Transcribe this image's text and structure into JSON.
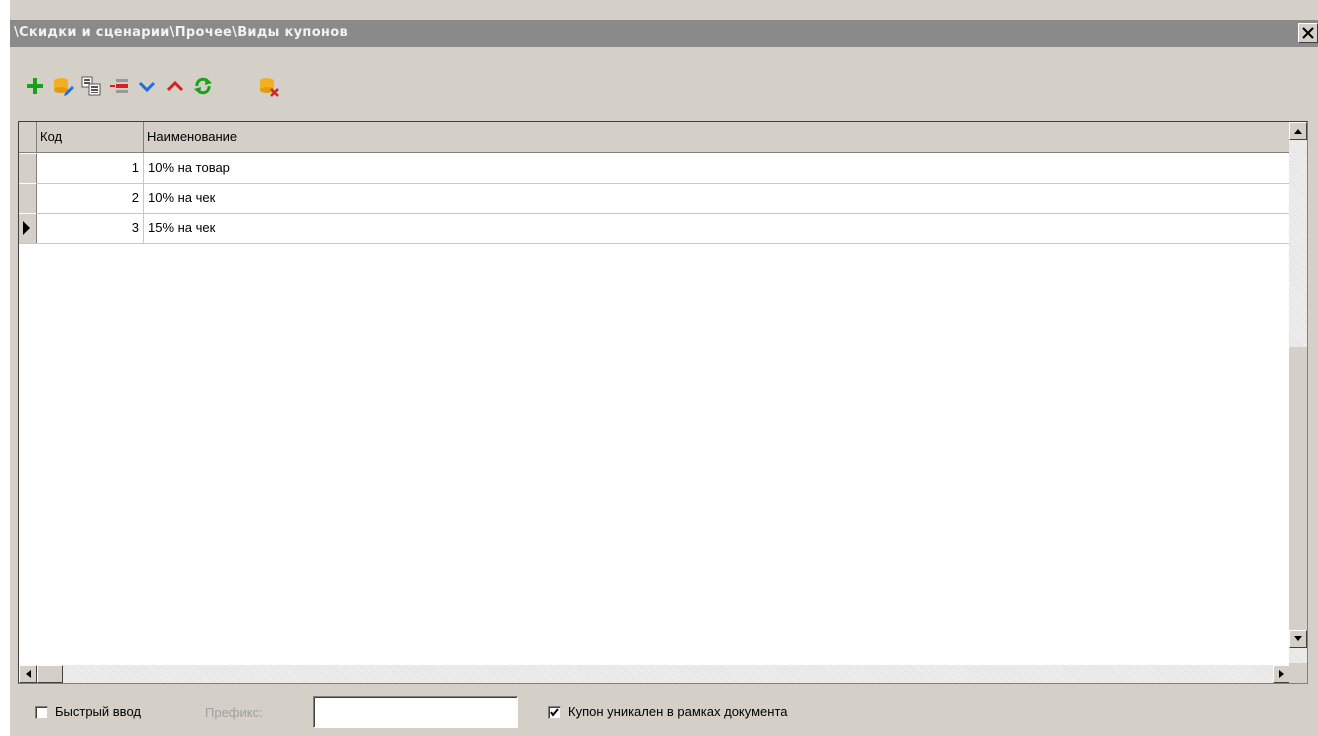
{
  "window": {
    "title": "\\Скидки и сценарии\\Прочее\\Виды купонов",
    "close_symbol": "✕"
  },
  "toolbar": {
    "buttons": [
      {
        "icon": "add-icon"
      },
      {
        "icon": "edit-record-icon"
      },
      {
        "icon": "copy-record-icon"
      },
      {
        "icon": "delete-record-icon"
      },
      {
        "icon": "move-down-icon"
      },
      {
        "icon": "move-up-icon"
      },
      {
        "icon": "refresh-icon"
      },
      {
        "icon": "delete-db-icon"
      }
    ]
  },
  "grid": {
    "columns": [
      "Код",
      "Наименование"
    ],
    "rows": [
      {
        "code": "1",
        "name": "10% на товар",
        "current": false
      },
      {
        "code": "2",
        "name": "10% на чек",
        "current": false
      },
      {
        "code": "3",
        "name": "15% на чек",
        "current": true
      }
    ]
  },
  "bottom": {
    "quick_input_label": "Быстрый ввод",
    "quick_input_checked": false,
    "prefix_label": "Префикс:",
    "prefix_value": "",
    "unique_label": "Купон уникален в рамках документа",
    "unique_checked": true
  },
  "colors": {
    "titlebar": "#8a8a8a",
    "face": "#d4d0c8",
    "add_green": "#1aa01a",
    "move_down_blue": "#1e6fd9",
    "move_up_red": "#d92020",
    "db_yellow": "#f2b01e"
  }
}
